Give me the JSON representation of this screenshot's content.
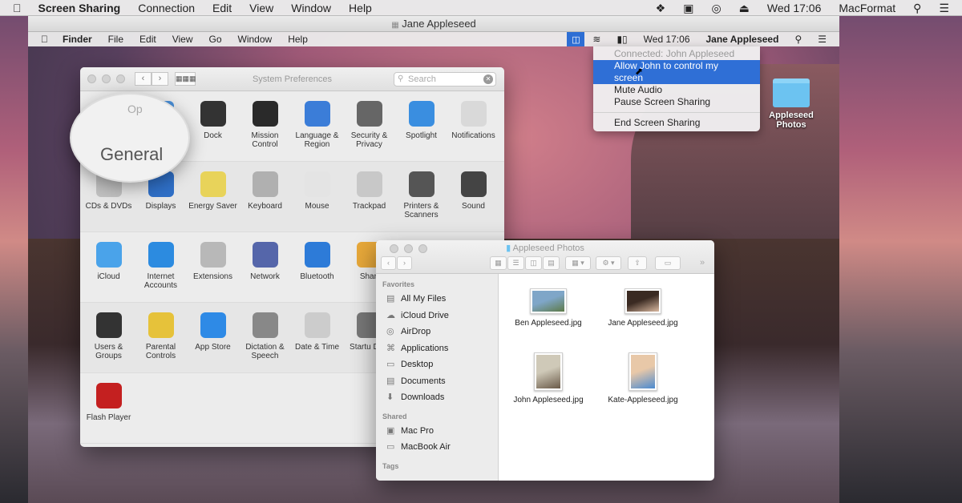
{
  "host_menubar": {
    "app": "Screen Sharing",
    "menus": [
      "Connection",
      "Edit",
      "View",
      "Window",
      "Help"
    ],
    "clock": "Wed 17:06",
    "user": "MacFormat",
    "icons": [
      "apple-icon",
      "dropbox-icon",
      "facetime-icon",
      "backup-icon",
      "eject-icon",
      "search-icon",
      "list-icon"
    ]
  },
  "remote": {
    "window_title": "Jane Appleseed",
    "menubar": {
      "app": "Finder",
      "menus": [
        "File",
        "Edit",
        "View",
        "Go",
        "Window",
        "Help"
      ],
      "clock": "Wed 17:06",
      "user": "Jane Appleseed"
    },
    "screen_sharing_menu": {
      "status": "Connected: John Appleseed",
      "items": [
        "Allow John to control my screen",
        "Mute Audio",
        "Pause Screen Sharing"
      ],
      "end": "End Screen Sharing",
      "selected_index": 0
    },
    "desktop_folder": {
      "label_line1": "Appleseed",
      "label_line2": "Photos"
    },
    "system_preferences": {
      "title": "System Preferences",
      "search_placeholder": "Search",
      "magnifier_label": "General",
      "magnifier_partial": "Op",
      "rows": [
        [
          {
            "label": "",
            "icon": "general-icon",
            "color": "#8a8a8a"
          },
          {
            "label": "ktop & n Saver",
            "icon": "desktop-icon",
            "color": "#4a90d9"
          },
          {
            "label": "Dock",
            "icon": "dock-icon",
            "color": "#333333"
          },
          {
            "label": "Mission Control",
            "icon": "mission-control-icon",
            "color": "#2a2a2a"
          },
          {
            "label": "Language & Region",
            "icon": "flag-icon",
            "color": "#3b7dd8"
          },
          {
            "label": "Security & Privacy",
            "icon": "house-icon",
            "color": "#666666"
          },
          {
            "label": "Spotlight",
            "icon": "magnifier-icon",
            "color": "#3a8ee0"
          },
          {
            "label": "Notifications",
            "icon": "notifications-icon",
            "color": "#d9d9d9"
          }
        ],
        [
          {
            "label": "CDs & DVDs",
            "icon": "cd-icon",
            "color": "#c0c0c0"
          },
          {
            "label": "Displays",
            "icon": "display-icon",
            "color": "#2f6fc6"
          },
          {
            "label": "Energy Saver",
            "icon": "bulb-icon",
            "color": "#e8d35a"
          },
          {
            "label": "Keyboard",
            "icon": "keyboard-icon",
            "color": "#b0b0b0"
          },
          {
            "label": "Mouse",
            "icon": "mouse-icon",
            "color": "#e4e4e4"
          },
          {
            "label": "Trackpad",
            "icon": "trackpad-icon",
            "color": "#c8c8c8"
          },
          {
            "label": "Printers & Scanners",
            "icon": "printer-icon",
            "color": "#555555"
          },
          {
            "label": "Sound",
            "icon": "speaker-icon",
            "color": "#444444"
          }
        ],
        [
          {
            "label": "iCloud",
            "icon": "icloud-icon",
            "color": "#4aa3ea"
          },
          {
            "label": "Internet Accounts",
            "icon": "at-icon",
            "color": "#2c8be0"
          },
          {
            "label": "Extensions",
            "icon": "puzzle-icon",
            "color": "#b8b8b8"
          },
          {
            "label": "Network",
            "icon": "globe-icon",
            "color": "#5566aa"
          },
          {
            "label": "Bluetooth",
            "icon": "bluetooth-icon",
            "color": "#2d7bd8"
          },
          {
            "label": "Shari",
            "icon": "sharing-icon",
            "color": "#e7a83a"
          }
        ],
        [
          {
            "label": "Users & Groups",
            "icon": "users-icon",
            "color": "#333333"
          },
          {
            "label": "Parental Controls",
            "icon": "parental-icon",
            "color": "#e6c23a"
          },
          {
            "label": "App Store",
            "icon": "appstore-icon",
            "color": "#2e8ae6"
          },
          {
            "label": "Dictation & Speech",
            "icon": "microphone-icon",
            "color": "#888888"
          },
          {
            "label": "Date & Time",
            "icon": "clock-icon",
            "color": "#cccccc"
          },
          {
            "label": "Startu Disk",
            "icon": "disk-icon",
            "color": "#777777"
          }
        ],
        [
          {
            "label": "Flash Player",
            "icon": "flash-icon",
            "color": "#c42020"
          }
        ]
      ]
    },
    "finder": {
      "title": "Appleseed Photos",
      "favorites_header": "Favorites",
      "favorites": [
        {
          "label": "All My Files",
          "icon": "allfiles-icon",
          "glyph": "▤"
        },
        {
          "label": "iCloud Drive",
          "icon": "icloud-drive-icon",
          "glyph": "☁"
        },
        {
          "label": "AirDrop",
          "icon": "airdrop-icon",
          "glyph": "◎"
        },
        {
          "label": "Applications",
          "icon": "applications-icon",
          "glyph": "⌘"
        },
        {
          "label": "Desktop",
          "icon": "desktop-folder-icon",
          "glyph": "▭"
        },
        {
          "label": "Documents",
          "icon": "documents-icon",
          "glyph": "▤"
        },
        {
          "label": "Downloads",
          "icon": "downloads-icon",
          "glyph": "⬇"
        }
      ],
      "shared_header": "Shared",
      "shared": [
        {
          "label": "Mac Pro",
          "icon": "macpro-icon",
          "glyph": "▣"
        },
        {
          "label": "MacBook Air",
          "icon": "macbook-icon",
          "glyph": "▭"
        }
      ],
      "tags_header": "Tags",
      "files": [
        {
          "name": "Ben Appleseed.jpg",
          "colors": [
            "#7fa6c8",
            "#5d7a48"
          ]
        },
        {
          "name": "Jane Appleseed.jpg",
          "colors": [
            "#3a2a22",
            "#d9b8a0"
          ]
        },
        {
          "name": "John Appleseed.jpg",
          "colors": [
            "#cfc9b8",
            "#6a5a48"
          ]
        },
        {
          "name": "Kate-Appleseed.jpg",
          "colors": [
            "#e8c8a8",
            "#4a8ad0"
          ]
        }
      ]
    }
  }
}
